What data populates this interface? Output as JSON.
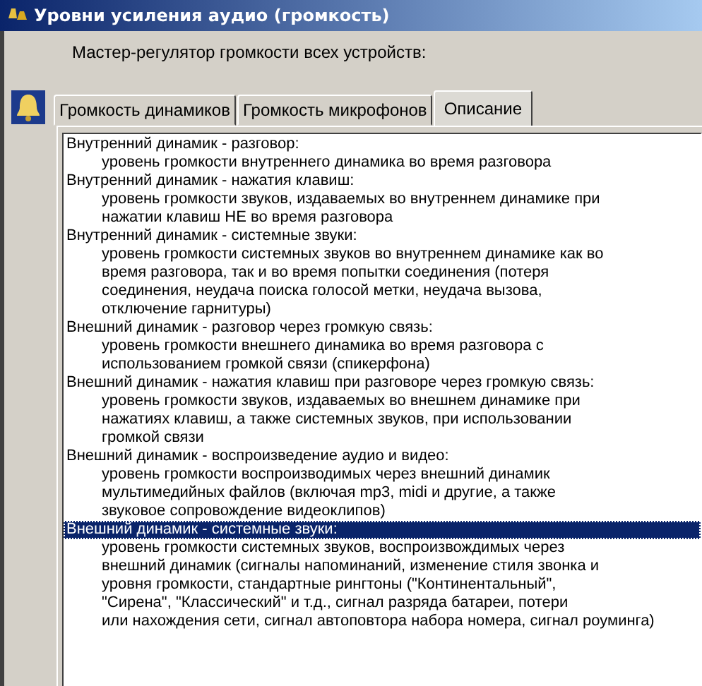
{
  "window": {
    "title": "Уровни усиления аудио (громкость)"
  },
  "master_label": "Мастер-регулятор громкости всех устройств:",
  "tabs": [
    {
      "label": "Громкость динамиков",
      "selected": false
    },
    {
      "label": "Громкость микрофонов",
      "selected": false
    },
    {
      "label": "Описание",
      "selected": true
    }
  ],
  "description_list": [
    {
      "title": "Внутренний динамик - разговор:",
      "selected": false,
      "lines": [
        "уровень громкости внутреннего динамика во время разговора"
      ]
    },
    {
      "title": "Внутренний динамик - нажатия клавиш:",
      "selected": false,
      "lines": [
        "уровень громкости звуков, издаваемых во внутреннем динамике при",
        "нажатии клавиш НЕ во время разговора"
      ]
    },
    {
      "title": "Внутренний динамик - системные звуки:",
      "selected": false,
      "lines": [
        "уровень громкости системных звуков во внутреннем динамике как во",
        "время разговора, так и во время попытки соединения (потеря",
        "соединения, неудача поиска голосой метки, неудача вызова,",
        "отключение гарнитуры)"
      ]
    },
    {
      "title": "Внешний динамик - разговор через громкую связь:",
      "selected": false,
      "lines": [
        "уровень громкости внешнего динамика во время разговора с",
        "использованием громкой связи (спикерфона)"
      ]
    },
    {
      "title": "Внешний динамик - нажатия клавиш при разговоре через громкую связь:",
      "selected": false,
      "lines": [
        "уровень громкости звуков, издаваемых во внешнем динамике при",
        "нажатиях клавиш, а также системных звуков, при использовании",
        "громкой связи"
      ]
    },
    {
      "title": "Внешний динамик - воспроизведение аудио и видео:",
      "selected": false,
      "lines": [
        "уровень громкости воспроизводимых через внешний динамик",
        "мультимедийных файлов (включая mp3, midi и другие, а также",
        "звуковое сопровождение видеоклипов)"
      ]
    },
    {
      "title": "Внешний динамик - системные звуки:",
      "selected": true,
      "lines": [
        "уровень громкости системных звуков, воспроизвождимых через",
        "внешний динамик (сигналы напоминаний, изменение стиля звонка и",
        "уровня громкости, стандартные рингтоны (\"Континентальный\",",
        "\"Сирена\", \"Классический\" и т.д., сигнал разряда батареи, потери",
        "или нахождения сети, сигнал автоповтора набора номера, сигнал роуминга)"
      ]
    }
  ]
}
